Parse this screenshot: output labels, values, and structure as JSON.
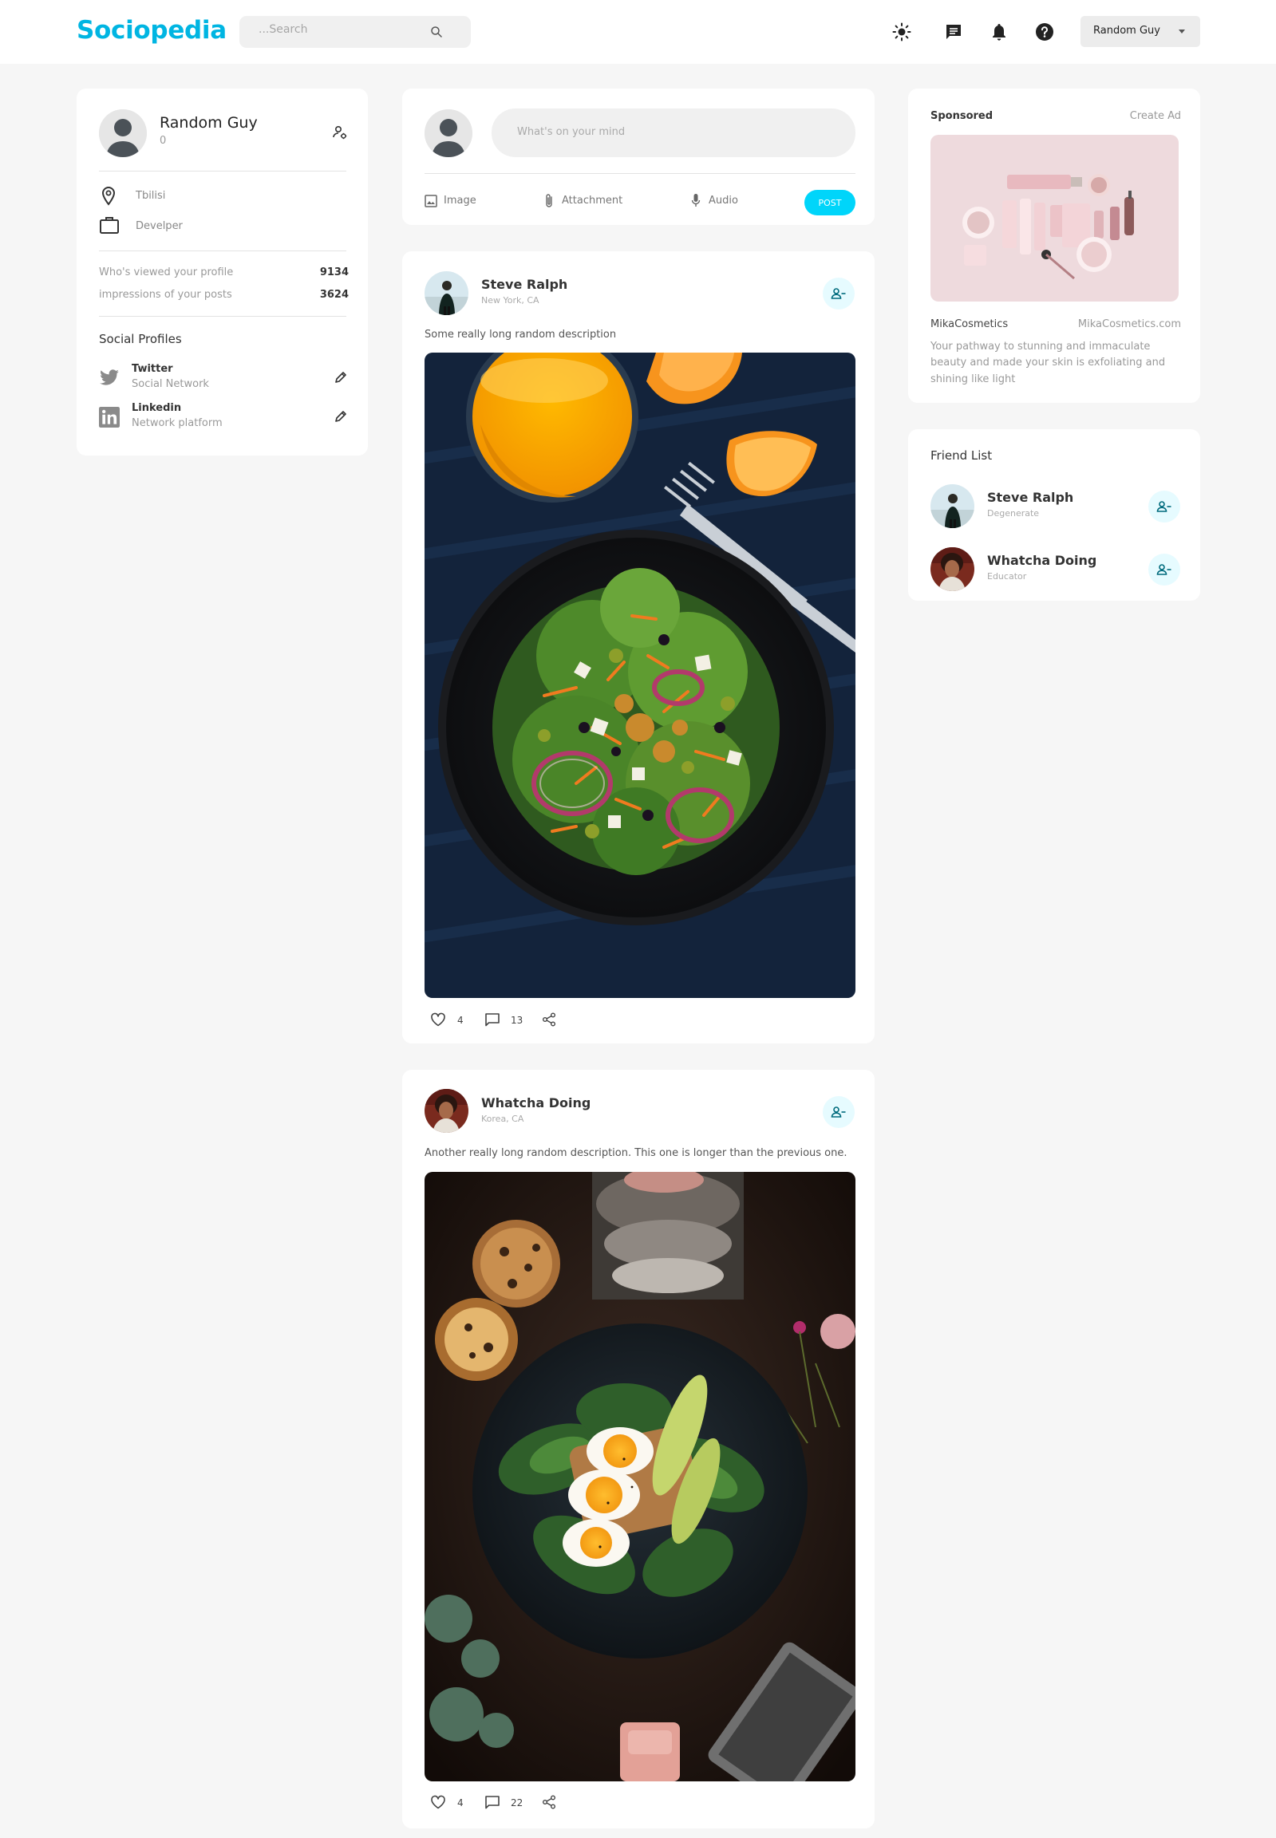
{
  "brand": {
    "logo": "Sociopedia",
    "accent": "#00b5e2"
  },
  "search": {
    "placeholder": "...Search"
  },
  "navbar": {
    "icons": [
      "light-mode-icon",
      "message-icon",
      "notifications-icon",
      "help-icon"
    ],
    "user_select": "Random Guy"
  },
  "profile": {
    "name": "Random Guy",
    "friends_count": "0",
    "location": "Tbilisi",
    "occupation": "Develper",
    "stats": [
      {
        "label": "Who's viewed your profile",
        "value": "9134"
      },
      {
        "label": "impressions of your posts",
        "value": "3624"
      }
    ],
    "social_title": "Social Profiles",
    "socials": [
      {
        "name": "Twitter",
        "sub": "Social Network"
      },
      {
        "name": "Linkedin",
        "sub": "Network platform"
      }
    ]
  },
  "composer": {
    "placeholder": "What's on your mind",
    "actions": [
      "Image",
      "Attachment",
      "Audio"
    ],
    "post_label": "POST"
  },
  "posts": [
    {
      "name": "Steve Ralph",
      "location": "New York, CA",
      "description": "Some really long random description",
      "likes": "4",
      "comments": "13"
    },
    {
      "name": "Whatcha Doing",
      "location": "Korea, CA",
      "description": "Another really long random description. This one is longer than the previous one.",
      "likes": "4",
      "comments": "22"
    }
  ],
  "sponsored": {
    "title": "Sponsored",
    "create_label": "Create Ad",
    "brand": "MikaCosmetics",
    "url": "MikaCosmetics.com",
    "text_lines": [
      "Your pathway to stunning and immaculate",
      "beauty and made your skin is exfoliating and",
      "shining like light"
    ]
  },
  "friends": {
    "title": "Friend List",
    "items": [
      {
        "name": "Steve Ralph",
        "sub": "Degenerate"
      },
      {
        "name": "Whatcha Doing",
        "sub": "Educator"
      }
    ]
  }
}
